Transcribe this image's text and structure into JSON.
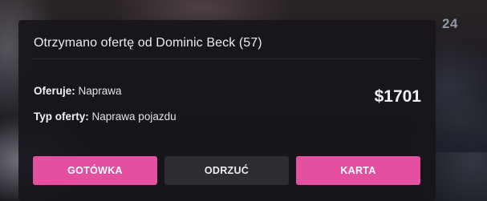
{
  "background": {
    "plate_number": "24"
  },
  "offer": {
    "title": "Otrzymano ofertę od Dominic Beck (57)",
    "offers_label": "Oferuje:",
    "offers_value": "Naprawa",
    "type_label": "Typ oferty:",
    "type_value": "Naprawa pojazdu",
    "price": "$1701"
  },
  "actions": {
    "cash_label": "GOTÓWKA",
    "reject_label": "ODRZUĆ",
    "card_label": "KARTA"
  },
  "colors": {
    "accent": "#e44fa0",
    "panel": "#18161c",
    "reject_button": "#2f2b33"
  }
}
